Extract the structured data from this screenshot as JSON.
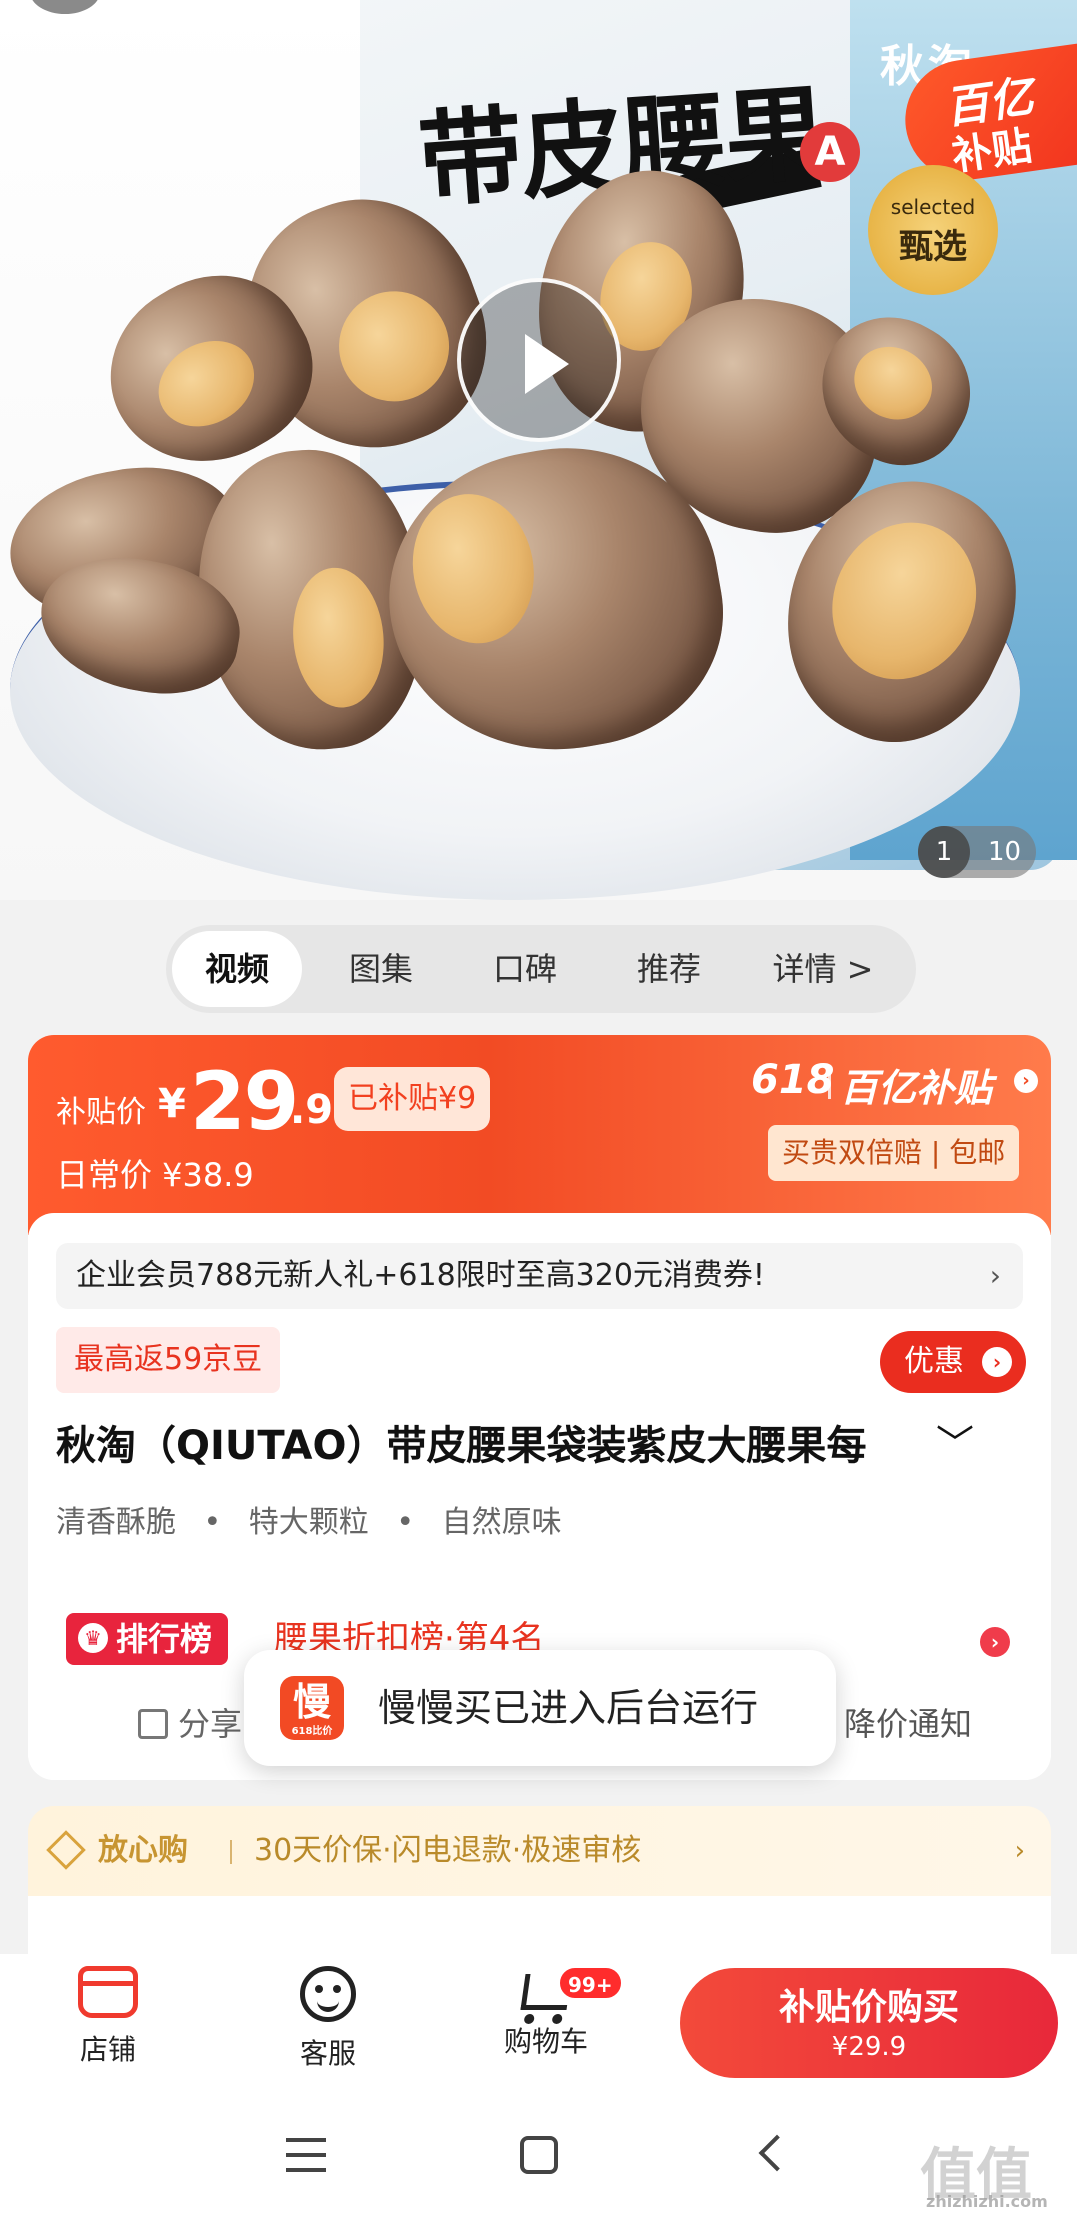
{
  "hero": {
    "bag_big_title": "带皮腰果",
    "bag_grade": "A",
    "bag_brand": "秋淘",
    "corner_badge_line1": "百亿",
    "corner_badge_line2": "补贴",
    "selected_line1": "selected",
    "selected_line2": "甄选",
    "current_image": "1",
    "total_images": "10"
  },
  "tabs": [
    {
      "label": "视频",
      "active": true
    },
    {
      "label": "图集",
      "active": false
    },
    {
      "label": "口碑",
      "active": false
    },
    {
      "label": "推荐",
      "active": false
    },
    {
      "label": "详情 >",
      "active": false
    }
  ],
  "price": {
    "subsidy_label": "补贴价",
    "currency": "¥",
    "integer": "29",
    "decimal": ".9",
    "subsidy_amount": "已补贴¥9",
    "daily_price": "日常价 ¥38.9",
    "event": "618",
    "program": "百亿补贴",
    "guarantee": "买贵双倍赔 | 包邮"
  },
  "promo": {
    "text": "企业会员788元新人礼+618限时至高320元消费券!",
    "arrow": "›"
  },
  "bean_reward": "最高返59京豆",
  "coupon_button": "优惠",
  "product": {
    "title": "秋淘（QIUTAO）带皮腰果袋装紫皮大腰果每",
    "features": [
      "清香酥脆",
      "•",
      "特大颗粒",
      "•",
      "自然原味"
    ]
  },
  "ranking": {
    "tag": "排行榜",
    "text": "腰果折扣榜·第4名"
  },
  "actions": {
    "share": "分享",
    "price_alert": "降价通知"
  },
  "toast": {
    "icon_char": "慢",
    "icon_sub": "618比价",
    "message": "慢慢买已进入后台运行"
  },
  "assurance": {
    "title": "放心购",
    "text": "30天价保·闪电退款·极速审核",
    "arrow": "›"
  },
  "bottom_bar": {
    "shop": "店铺",
    "service": "客服",
    "cart": "购物车",
    "cart_count": "99+",
    "buy_label": "补贴价购买",
    "buy_price": "¥29.9"
  },
  "watermark": {
    "text": "值值值",
    "url": "zhizhizhi.com"
  }
}
